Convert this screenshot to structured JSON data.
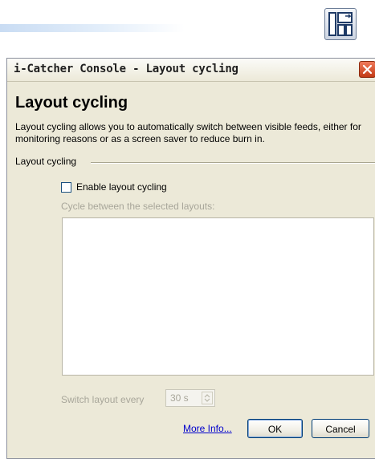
{
  "window": {
    "title": "i-Catcher Console - Layout cycling"
  },
  "page": {
    "heading": "Layout cycling",
    "description": "Layout cycling allows you to automatically switch between visible feeds, either for monitoring reasons or as a screen saver to reduce burn in."
  },
  "group": {
    "label": "Layout cycling"
  },
  "options": {
    "enable_label": "Enable layout cycling",
    "enable_checked": false,
    "cycle_label": "Cycle between the selected layouts:",
    "layouts": [],
    "switch_label": "Switch layout every",
    "switch_interval": "30 s"
  },
  "footer": {
    "more_info": "More Info...",
    "ok_label": "OK",
    "cancel_label": "Cancel"
  },
  "icons": {
    "app": "layout-grid-icon",
    "close": "close-icon",
    "spin_up": "spin-up-icon",
    "spin_down": "spin-down-icon"
  },
  "colors": {
    "close_button": "#c23a14",
    "link": "#0000cc",
    "disabled_text": "#a8a69a",
    "dialog_background": "#ece9d8"
  }
}
